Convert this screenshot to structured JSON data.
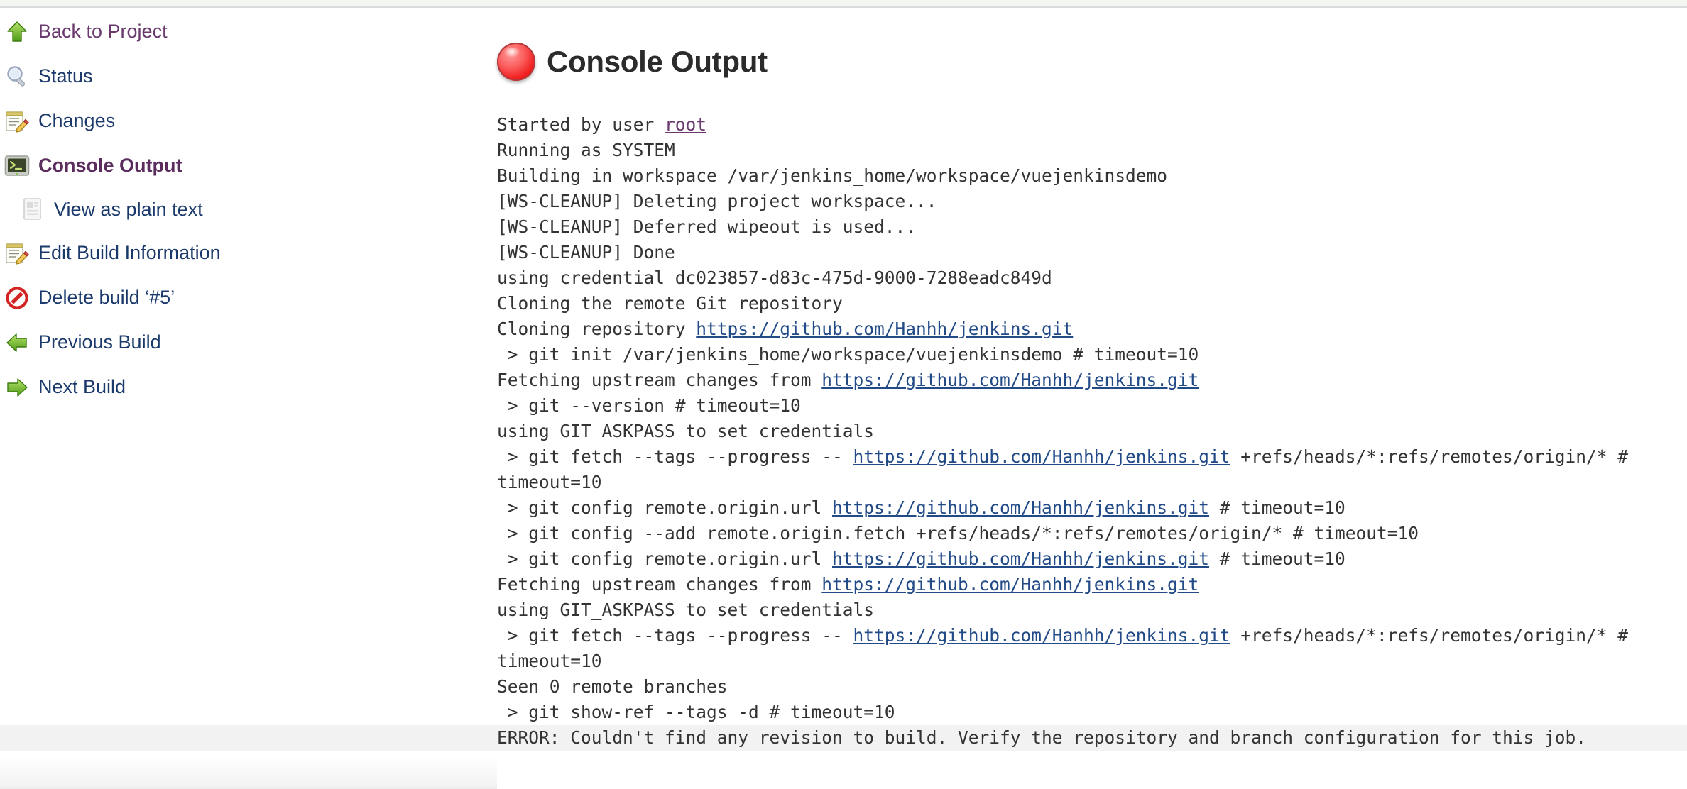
{
  "sidebar": {
    "items": [
      {
        "icon": "arrow-up-icon",
        "label": "Back to Project",
        "state": "visited",
        "indent": false
      },
      {
        "icon": "search-icon",
        "label": "Status",
        "state": "link",
        "indent": false
      },
      {
        "icon": "notepad-edit-icon",
        "label": "Changes",
        "state": "link",
        "indent": false
      },
      {
        "icon": "terminal-icon",
        "label": "Console Output",
        "state": "current",
        "indent": false
      },
      {
        "icon": "document-icon",
        "label": "View as plain text",
        "state": "link",
        "indent": true
      },
      {
        "icon": "notepad-edit-icon",
        "label": "Edit Build Information",
        "state": "link",
        "indent": false
      },
      {
        "icon": "no-entry-icon",
        "label": "Delete build ‘#5’",
        "state": "link",
        "indent": false
      },
      {
        "icon": "arrow-left-icon",
        "label": "Previous Build",
        "state": "link",
        "indent": false
      },
      {
        "icon": "arrow-right-icon",
        "label": "Next Build",
        "state": "link",
        "indent": false
      }
    ]
  },
  "main": {
    "status_icon": "red-ball-failed-icon",
    "title": "Console Output"
  },
  "console": {
    "lines": [
      {
        "id": "l01",
        "segments": [
          {
            "t": "Started by user "
          },
          {
            "t": "root",
            "link": true,
            "visited": true
          }
        ]
      },
      {
        "id": "l02",
        "segments": [
          {
            "t": "Running as SYSTEM"
          }
        ]
      },
      {
        "id": "l03",
        "segments": [
          {
            "t": "Building in workspace /var/jenkins_home/workspace/vuejenkinsdemo"
          }
        ]
      },
      {
        "id": "l04",
        "segments": [
          {
            "t": "[WS-CLEANUP] Deleting project workspace..."
          }
        ]
      },
      {
        "id": "l05",
        "segments": [
          {
            "t": "[WS-CLEANUP] Deferred wipeout is used..."
          }
        ]
      },
      {
        "id": "l06",
        "segments": [
          {
            "t": "[WS-CLEANUP] Done"
          }
        ]
      },
      {
        "id": "l07",
        "segments": [
          {
            "t": "using credential dc023857-d83c-475d-9000-7288eadc849d"
          }
        ]
      },
      {
        "id": "l08",
        "segments": [
          {
            "t": "Cloning the remote Git repository"
          }
        ]
      },
      {
        "id": "l09",
        "segments": [
          {
            "t": "Cloning repository "
          },
          {
            "t": "https://github.com/Hanhh/jenkins.git",
            "link": true
          }
        ]
      },
      {
        "id": "l10",
        "segments": [
          {
            "t": " > git init /var/jenkins_home/workspace/vuejenkinsdemo # timeout=10"
          }
        ]
      },
      {
        "id": "l11",
        "segments": [
          {
            "t": "Fetching upstream changes from "
          },
          {
            "t": "https://github.com/Hanhh/jenkins.git",
            "link": true
          }
        ]
      },
      {
        "id": "l12",
        "segments": [
          {
            "t": " > git --version # timeout=10"
          }
        ]
      },
      {
        "id": "l13",
        "segments": [
          {
            "t": "using GIT_ASKPASS to set credentials"
          }
        ]
      },
      {
        "id": "l14",
        "segments": [
          {
            "t": " > git fetch --tags --progress -- "
          },
          {
            "t": "https://github.com/Hanhh/jenkins.git",
            "link": true
          },
          {
            "t": " +refs/heads/*:refs/remotes/origin/* #"
          }
        ]
      },
      {
        "id": "l15",
        "segments": [
          {
            "t": "timeout=10"
          }
        ]
      },
      {
        "id": "l16",
        "segments": [
          {
            "t": " > git config remote.origin.url "
          },
          {
            "t": "https://github.com/Hanhh/jenkins.git",
            "link": true
          },
          {
            "t": " # timeout=10"
          }
        ]
      },
      {
        "id": "l17",
        "segments": [
          {
            "t": " > git config --add remote.origin.fetch +refs/heads/*:refs/remotes/origin/* # timeout=10"
          }
        ]
      },
      {
        "id": "l18",
        "segments": [
          {
            "t": " > git config remote.origin.url "
          },
          {
            "t": "https://github.com/Hanhh/jenkins.git",
            "link": true
          },
          {
            "t": " # timeout=10"
          }
        ]
      },
      {
        "id": "l19",
        "segments": [
          {
            "t": "Fetching upstream changes from "
          },
          {
            "t": "https://github.com/Hanhh/jenkins.git",
            "link": true
          }
        ]
      },
      {
        "id": "l20",
        "segments": [
          {
            "t": "using GIT_ASKPASS to set credentials"
          }
        ]
      },
      {
        "id": "l21",
        "segments": [
          {
            "t": " > git fetch --tags --progress -- "
          },
          {
            "t": "https://github.com/Hanhh/jenkins.git",
            "link": true
          },
          {
            "t": " +refs/heads/*:refs/remotes/origin/* #"
          }
        ]
      },
      {
        "id": "l22",
        "segments": [
          {
            "t": "timeout=10"
          }
        ]
      },
      {
        "id": "l23",
        "segments": [
          {
            "t": "Seen 0 remote branches"
          }
        ]
      },
      {
        "id": "l24",
        "segments": [
          {
            "t": " > git show-ref --tags -d # timeout=10"
          }
        ]
      },
      {
        "id": "l25",
        "error": true,
        "segments": [
          {
            "t": "ERROR: Couldn't find any revision to build. Verify the repository and branch configuration for this job."
          }
        ]
      }
    ]
  },
  "colors": {
    "link": "#214a87",
    "visited_link": "#6a3a6e",
    "current_item": "#5b2d5e",
    "status_failed": "#f02020",
    "error_row_bg": "#f2f2f2"
  }
}
